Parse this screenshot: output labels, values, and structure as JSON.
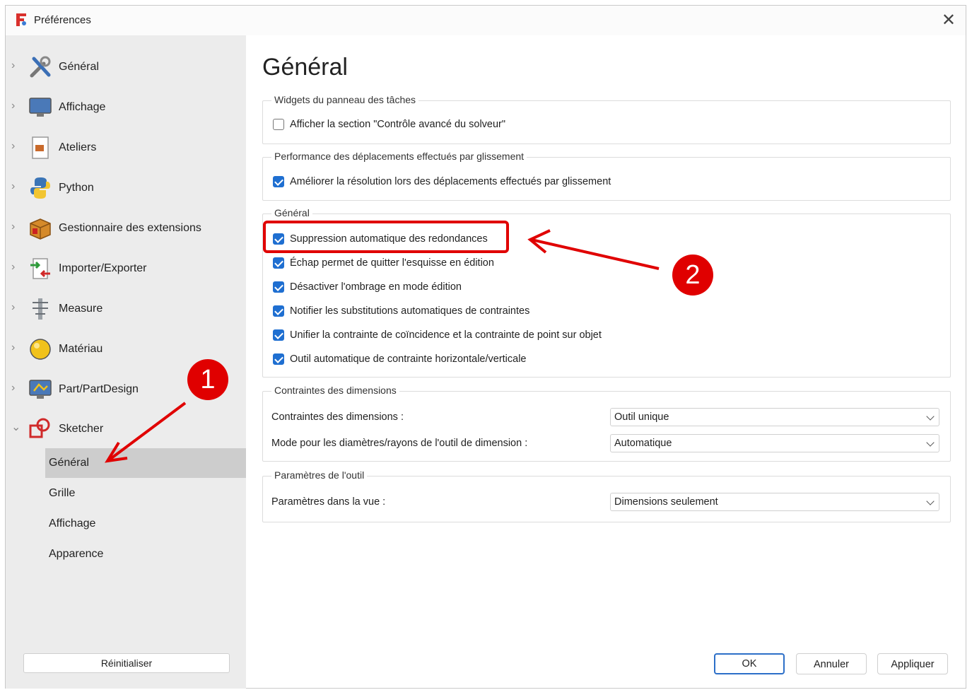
{
  "window": {
    "title": "Préférences",
    "close_symbol": "✕"
  },
  "sidebar": {
    "items": [
      {
        "label": "Général",
        "icon": "tools-icon",
        "chevron": "›"
      },
      {
        "label": "Affichage",
        "icon": "monitor-icon",
        "chevron": "›"
      },
      {
        "label": "Ateliers",
        "icon": "workbench-icon",
        "chevron": "›"
      },
      {
        "label": "Python",
        "icon": "python-icon",
        "chevron": "›"
      },
      {
        "label": "Gestionnaire des extensions",
        "icon": "addon-box-icon",
        "chevron": "›"
      },
      {
        "label": "Importer/Exporter",
        "icon": "import-export-icon",
        "chevron": "›"
      },
      {
        "label": "Measure",
        "icon": "measure-icon",
        "chevron": "›"
      },
      {
        "label": "Matériau",
        "icon": "material-sphere-icon",
        "chevron": "›"
      },
      {
        "label": "Part/PartDesign",
        "icon": "part-design-icon",
        "chevron": "›"
      },
      {
        "label": "Sketcher",
        "icon": "sketcher-icon",
        "chevron": "⌄",
        "expanded": true
      }
    ],
    "sketcher_children": [
      "Général",
      "Grille",
      "Affichage",
      "Apparence"
    ],
    "selected_child": "Général",
    "reset_label": "Réinitialiser"
  },
  "main": {
    "title": "Général",
    "groups": {
      "widgets": {
        "title": "Widgets du panneau des tâches",
        "options": [
          {
            "label": "Afficher la section \"Contrôle avancé du solveur\"",
            "checked": false
          }
        ]
      },
      "drag": {
        "title": "Performance des déplacements effectués par glissement",
        "options": [
          {
            "label": "Améliorer la résolution lors des déplacements effectués par glissement",
            "checked": true
          }
        ]
      },
      "general": {
        "title": "Général",
        "options": [
          {
            "label": "Suppression automatique des redondances",
            "checked": true
          },
          {
            "label": "Échap permet de quitter l'esquisse en édition",
            "checked": true
          },
          {
            "label": "Désactiver l'ombrage en mode édition",
            "checked": true
          },
          {
            "label": "Notifier les substitutions automatiques de contraintes",
            "checked": true
          },
          {
            "label": "Unifier la contrainte de coïncidence et la contrainte de point sur objet",
            "checked": true
          },
          {
            "label": "Outil automatique de contrainte horizontale/verticale",
            "checked": true
          }
        ]
      },
      "dimensions": {
        "title": "Contraintes des dimensions",
        "fields": [
          {
            "label": "Contraintes des dimensions :",
            "value": "Outil unique"
          },
          {
            "label": "Mode pour les diamètres/rayons de l'outil de dimension :",
            "value": "Automatique"
          }
        ]
      },
      "tool": {
        "title": "Paramètres de l'outil",
        "fields": [
          {
            "label": "Paramètres dans la vue :",
            "value": "Dimensions seulement"
          }
        ]
      }
    }
  },
  "footer": {
    "ok": "OK",
    "cancel": "Annuler",
    "apply": "Appliquer"
  },
  "annotations": {
    "badge_1": "1",
    "badge_2": "2",
    "color": "#e00000"
  },
  "colors": {
    "accent": "#1f6fd1",
    "sidebar_bg": "#ececec",
    "selected_bg": "#cdcdcd"
  }
}
